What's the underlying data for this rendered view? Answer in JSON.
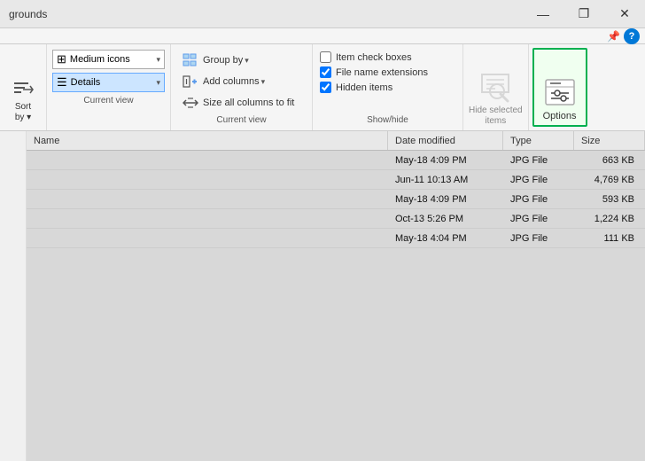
{
  "window": {
    "title": "grounds",
    "controls": {
      "minimize": "—",
      "maximize": "❐",
      "close": "✕"
    }
  },
  "ribbon": {
    "view_section": {
      "label": "Current view"
    },
    "sort_section": {
      "label": "Sort\nby ▾",
      "label_text": "Sort\nby"
    },
    "current_view": {
      "options": [
        {
          "icon": "⊞",
          "label": "Medium icons",
          "selected": false
        },
        {
          "icon": "☰",
          "label": "Details",
          "selected": true
        }
      ],
      "dropdown_arrow": "▾",
      "label": "Current view"
    },
    "group_section": {
      "items": [
        {
          "icon": "⊞",
          "label": "Group by ▾"
        },
        {
          "icon": "☰",
          "label": "Add columns ▾"
        },
        {
          "icon": "↔",
          "label": "Size all columns to fit"
        }
      ],
      "label": "Current view"
    },
    "showhide_section": {
      "checkboxes": [
        {
          "label": "Item check boxes",
          "checked": false
        },
        {
          "label": "File name extensions",
          "checked": true
        },
        {
          "label": "Hidden items",
          "checked": true
        }
      ],
      "label": "Show/hide"
    },
    "hide_selected": {
      "label": "Hide selected\nitems",
      "label_line1": "Hide selected",
      "label_line2": "items"
    },
    "options": {
      "label": "Options"
    },
    "help": "?"
  },
  "files": {
    "columns": [
      "Name",
      "Date modified",
      "Type",
      "Size"
    ],
    "rows": [
      {
        "name": "",
        "date": "May-18 4:09 PM",
        "type": "JPG File",
        "size": "663 KB"
      },
      {
        "name": "",
        "date": "Jun-11 10:13 AM",
        "type": "JPG File",
        "size": "4,769 KB"
      },
      {
        "name": "",
        "date": "May-18 4:09 PM",
        "type": "JPG File",
        "size": "593 KB"
      },
      {
        "name": "",
        "date": "Oct-13 5:26 PM",
        "type": "JPG File",
        "size": "1,224 KB"
      },
      {
        "name": "",
        "date": "May-18 4:04 PM",
        "type": "JPG File",
        "size": "111 KB"
      }
    ]
  },
  "pin": {
    "symbol": "📌"
  }
}
